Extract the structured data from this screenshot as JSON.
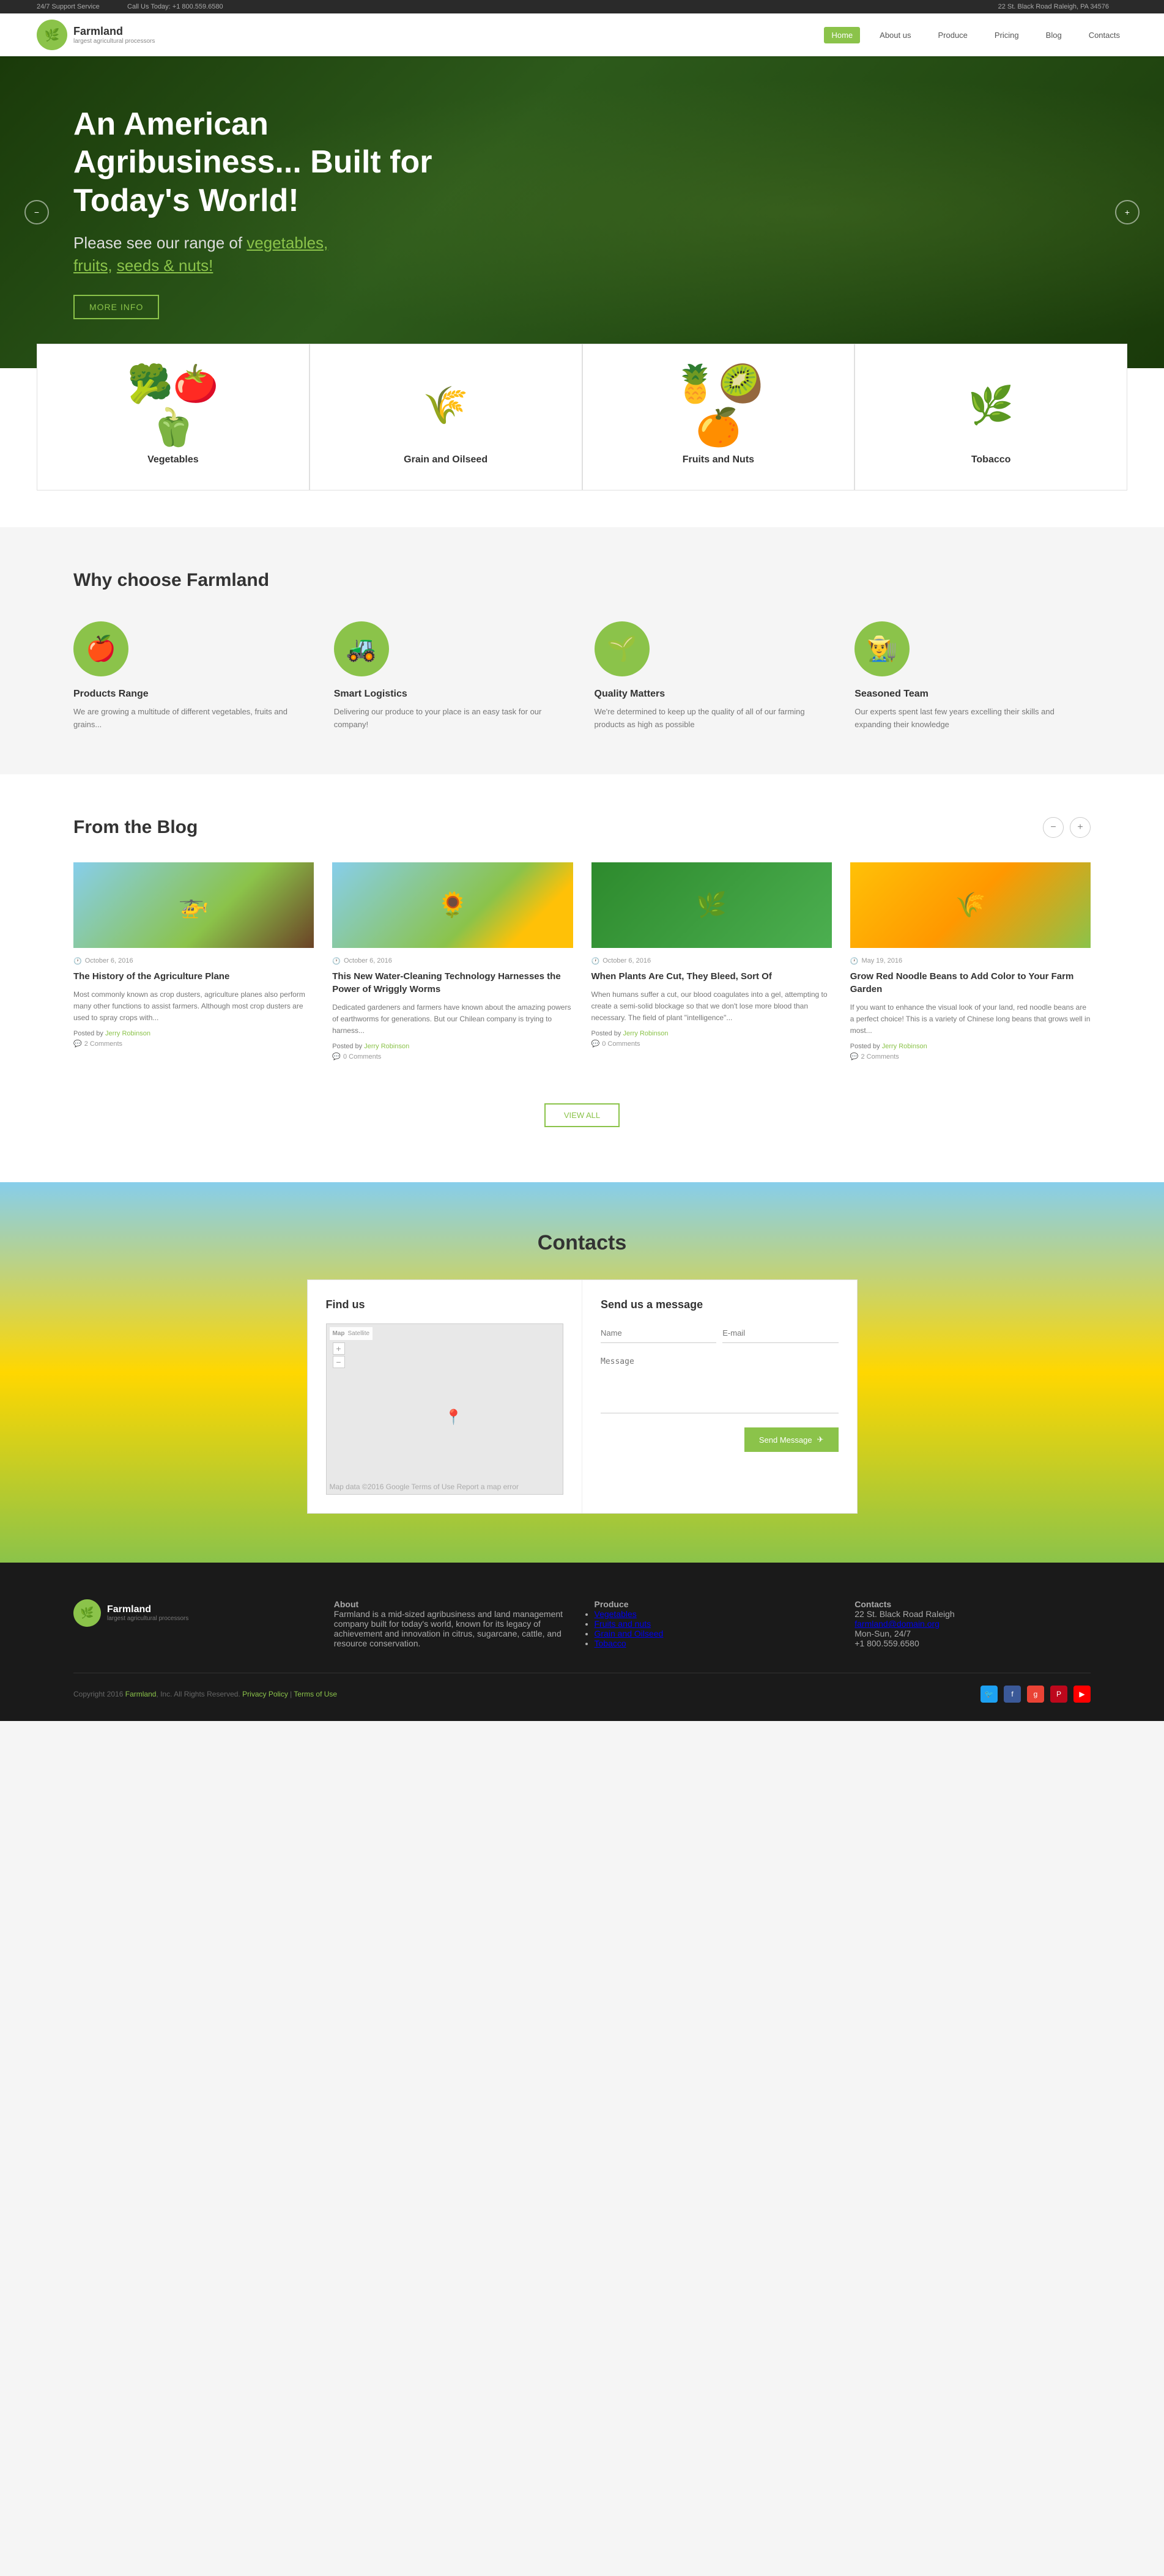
{
  "topbar": {
    "support": "24/7 Support Service",
    "call": "Call Us Today: +1 800.559.6580",
    "address": "22 St. Black Road Raleigh, PA 34576"
  },
  "nav": {
    "brand": "Farmland",
    "tagline": "largest agricultural processors",
    "links": [
      {
        "label": "Home",
        "active": true
      },
      {
        "label": "About us",
        "active": false
      },
      {
        "label": "Produce",
        "active": false
      },
      {
        "label": "Pricing",
        "active": false
      },
      {
        "label": "Blog",
        "active": false
      },
      {
        "label": "Contacts",
        "active": false
      }
    ]
  },
  "hero": {
    "headline": "An American Agribusiness... Built for Today's World!",
    "subtext": "Please see our range of vegetables, fruits, seeds & nuts!",
    "cta": "More Info"
  },
  "products": [
    {
      "name": "Vegetables",
      "emoji": "🥦"
    },
    {
      "name": "Grain and Oilseed",
      "emoji": "🌾"
    },
    {
      "name": "Fruits and Nuts",
      "emoji": "🍍"
    },
    {
      "name": "Tobacco",
      "emoji": "🌿"
    }
  ],
  "why": {
    "title": "Why choose Farmland",
    "items": [
      {
        "title": "Products Range",
        "desc": "We are growing a multitude of different vegetables, fruits and grains...",
        "emoji": "🍎"
      },
      {
        "title": "Smart Logistics",
        "desc": "Delivering our produce to your place is an easy task for our company!",
        "emoji": "🚜"
      },
      {
        "title": "Quality Matters",
        "desc": "We're determined to keep up the quality of all of our farming products as high as possible",
        "emoji": "🌱"
      },
      {
        "title": "Seasoned Team",
        "desc": "Our experts spent last few years excelling their skills and expanding their knowledge",
        "emoji": "👨‍🌾"
      }
    ]
  },
  "blog": {
    "title": "From the Blog",
    "view_all": "View all",
    "posts": [
      {
        "date": "October 6, 2016",
        "title": "The History of the Agriculture Plane",
        "excerpt": "Most commonly known as crop dusters, agriculture planes also perform many other functions to assist farmers. Although most crop dusters are used to spray crops with...",
        "author": "Jerry Robinson",
        "comments": "2 Comments",
        "img_type": "farm"
      },
      {
        "date": "October 6, 2016",
        "title": "This New Water-Cleaning Technology Harnesses the Power of Wriggly Worms",
        "excerpt": "Dedicated gardeners and farmers have known about the amazing powers of earthworms for generations. But our Chilean company is trying to harness...",
        "author": "Jerry Robinson",
        "comments": "0 Comments",
        "img_type": "sunflower"
      },
      {
        "date": "October 6, 2016",
        "title": "When Plants Are Cut, They Bleed, Sort Of",
        "excerpt": "When humans suffer a cut, our blood coagulates into a gel, attempting to create a semi-solid blockage so that we don't lose more blood than necessary. The field of plant \"intelligence\"...",
        "author": "Jerry Robinson",
        "comments": "0 Comments",
        "img_type": "plant"
      },
      {
        "date": "May 19, 2016",
        "title": "Grow Red Noodle Beans to Add Color to Your Farm Garden",
        "excerpt": "If you want to enhance the visual look of your land, red noodle beans are a perfect choice! This is a variety of Chinese long beans that grows well in most...",
        "author": "Jerry Robinson",
        "comments": "2 Comments",
        "img_type": "harvest"
      }
    ]
  },
  "contacts": {
    "title": "Contacts",
    "find_us": "Find us",
    "send_message": "Send us a message",
    "form": {
      "name_placeholder": "Name",
      "email_placeholder": "E-mail",
      "message_placeholder": "Message",
      "send_btn": "Send Message"
    },
    "map_tabs": [
      "Map",
      "Satellite"
    ]
  },
  "footer": {
    "brand": "Farmland",
    "tagline": "largest agricultural processors",
    "about_title": "About",
    "about_text": "Farmland is a mid-sized agribusiness and land management company built for today's world, known for its legacy of achievement and innovation in citrus, sugarcane, cattle, and resource conservation.",
    "produce_title": "Produce",
    "produce_links": [
      "Vegetables",
      "Fruits and nuts",
      "Grain and Oilseed",
      "Tobacco"
    ],
    "contacts_title": "Contacts",
    "contact_address": "22 St. Black Road Raleigh",
    "contact_email": "farmland@domain.org",
    "contact_hours": "Mon-Sun, 24/7",
    "contact_phone": "+1 800.559.6580",
    "copyright": "Copyright 2016 Farmland, Inc. All Rights Reserved.",
    "privacy": "Privacy Policy",
    "terms": "Terms of Use"
  }
}
